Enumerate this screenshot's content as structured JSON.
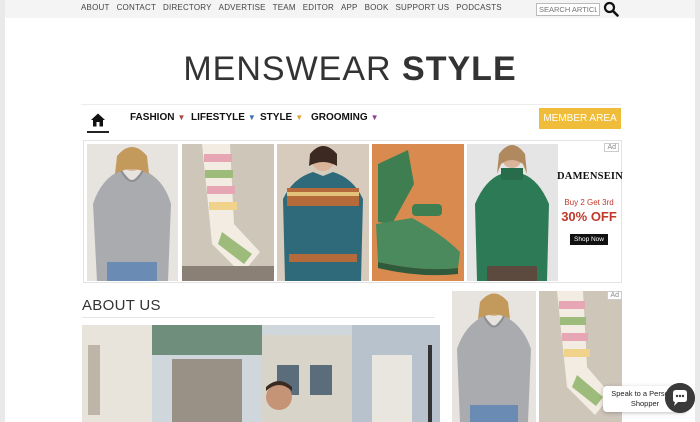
{
  "top_links": [
    "ABOUT",
    "CONTACT",
    "DIRECTORY",
    "ADVERTISE",
    "TEAM",
    "EDITOR",
    "APP",
    "BOOK",
    "SUPPORT US",
    "PODCASTS"
  ],
  "search": {
    "placeholder": "SEARCH ARTICLES"
  },
  "logo": {
    "light": "MENSWEAR ",
    "bold": "STYLE"
  },
  "nav": {
    "items": [
      {
        "label": "FASHION",
        "caret_color": "#b0413e"
      },
      {
        "label": "LIFESTYLE",
        "caret_color": "#3b6fb6"
      },
      {
        "label": "STYLE",
        "caret_color": "#e0a43a"
      },
      {
        "label": "GROOMING",
        "caret_color": "#8e3e8c"
      }
    ],
    "member_button": "MEMBER AREA"
  },
  "ad": {
    "badge": "Ad",
    "brand": "DAMENSEIN",
    "promo_line1": "Buy 2 Get 3rd",
    "promo_line2": "30% OFF",
    "cta": "Shop Now"
  },
  "about": {
    "title": "ABOUT US"
  },
  "side_ad": {
    "badge": "Ad"
  },
  "chat": {
    "label": "Speak to a Personal Shopper"
  },
  "colors": {
    "member_button": "#f0bd3b",
    "promo": "#c0392b"
  }
}
